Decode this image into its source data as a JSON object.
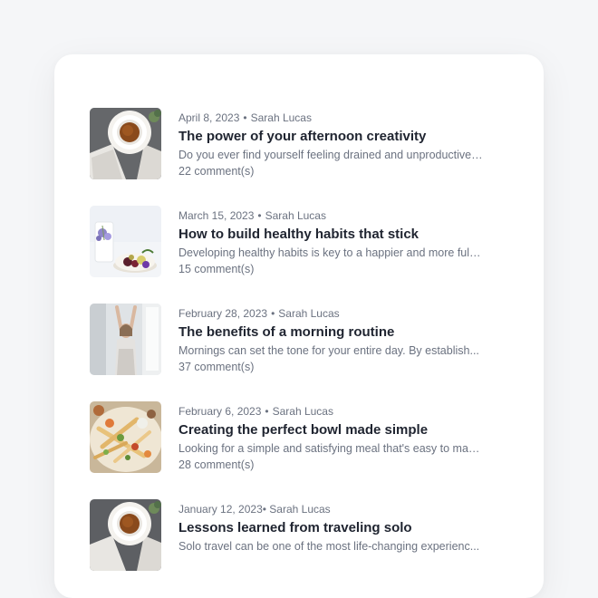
{
  "posts": [
    {
      "date": "April 8, 2023",
      "author": "Sarah Lucas",
      "title": "The power of your afternoon creativity",
      "excerpt": "Do you ever find yourself feeling drained and unproductive in...",
      "comments": "22 comment(s)",
      "thumbnail_icon": "tea-cup-image"
    },
    {
      "date": "March 15, 2023",
      "author": "Sarah Lucas",
      "title": "How to build healthy habits that stick",
      "excerpt": "Developing healthy habits is key to a happier and more fulfil...",
      "comments": "15 comment(s)",
      "thumbnail_icon": "fruit-bowl-image"
    },
    {
      "date": "February 28, 2023",
      "author": "Sarah Lucas",
      "title": "The benefits of a morning routine",
      "excerpt": "Mornings can set the tone for your entire day. By establish...",
      "comments": "37 comment(s)",
      "thumbnail_icon": "stretching-woman-image"
    },
    {
      "date": "February 6, 2023",
      "author": "Sarah Lucas",
      "title": "Creating the perfect bowl made simple",
      "excerpt": "Looking for a simple and satisfying meal that's easy to make...",
      "comments": "28 comment(s)",
      "thumbnail_icon": "food-platter-image"
    },
    {
      "date": "January 12, 2023",
      "author": "Sarah Lucas",
      "title": "Lessons learned from traveling solo",
      "excerpt": "Solo travel can be one of the most life-changing experienc...",
      "comments": "",
      "thumbnail_icon": "tea-cup-image"
    }
  ]
}
